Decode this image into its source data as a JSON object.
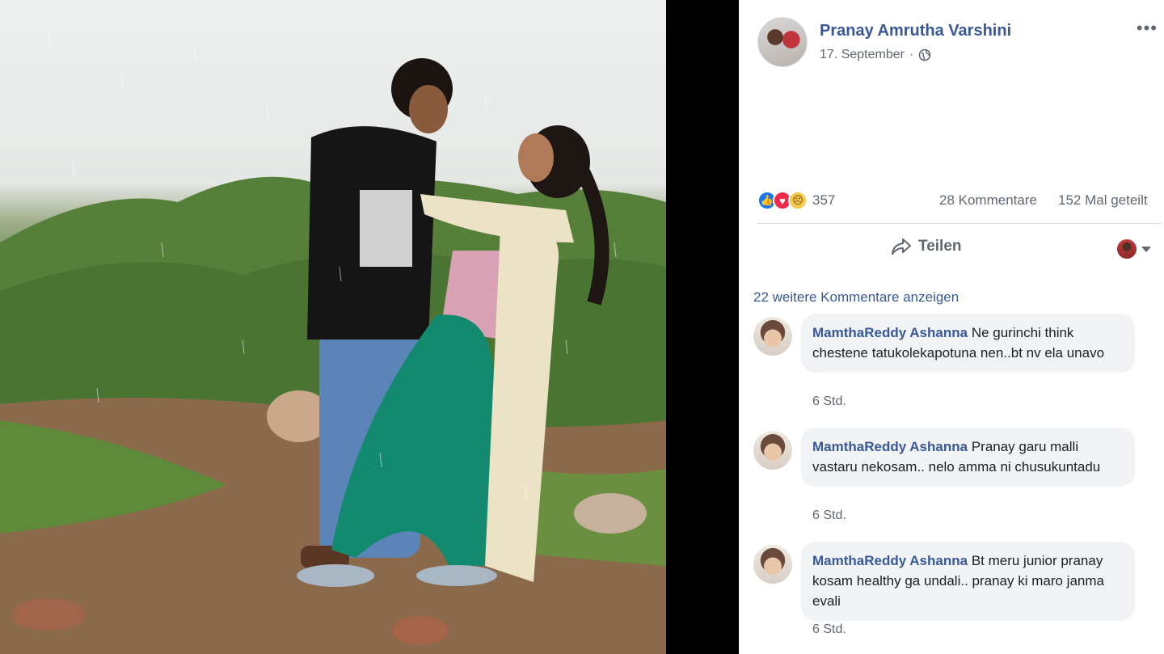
{
  "post": {
    "author": "Pranay Amrutha Varshini",
    "date": "17. September",
    "more_label": "•••"
  },
  "reactions": {
    "count": "357",
    "comments": "28 Kommentare",
    "shares": "152 Mal geteilt"
  },
  "actions": {
    "share_label": "Teilen"
  },
  "comments": {
    "more_label": "22 weitere Kommentare anzeigen",
    "items": [
      {
        "author": "MamthaReddy Ashanna",
        "text": "Ne gurinchi think chestene tatukolekapotuna nen..bt nv ela unavo",
        "time": "6 Std."
      },
      {
        "author": "MamthaReddy Ashanna",
        "text": "Pranay garu malli vastaru nekosam.. nelo amma ni chusukuntadu",
        "time": "6 Std."
      },
      {
        "author": "MamthaReddy Ashanna",
        "text": "Bt meru junior pranay kosam healthy ga undali.. pranay ki maro janma evali",
        "time": "6 Std."
      }
    ]
  },
  "icons": [
    "globe-icon",
    "like-icon",
    "love-icon",
    "sad-icon",
    "share-icon",
    "caret-down-icon"
  ],
  "colors": {
    "link": "#385898",
    "meta": "#616770",
    "bubble": "#f2f3f5"
  }
}
